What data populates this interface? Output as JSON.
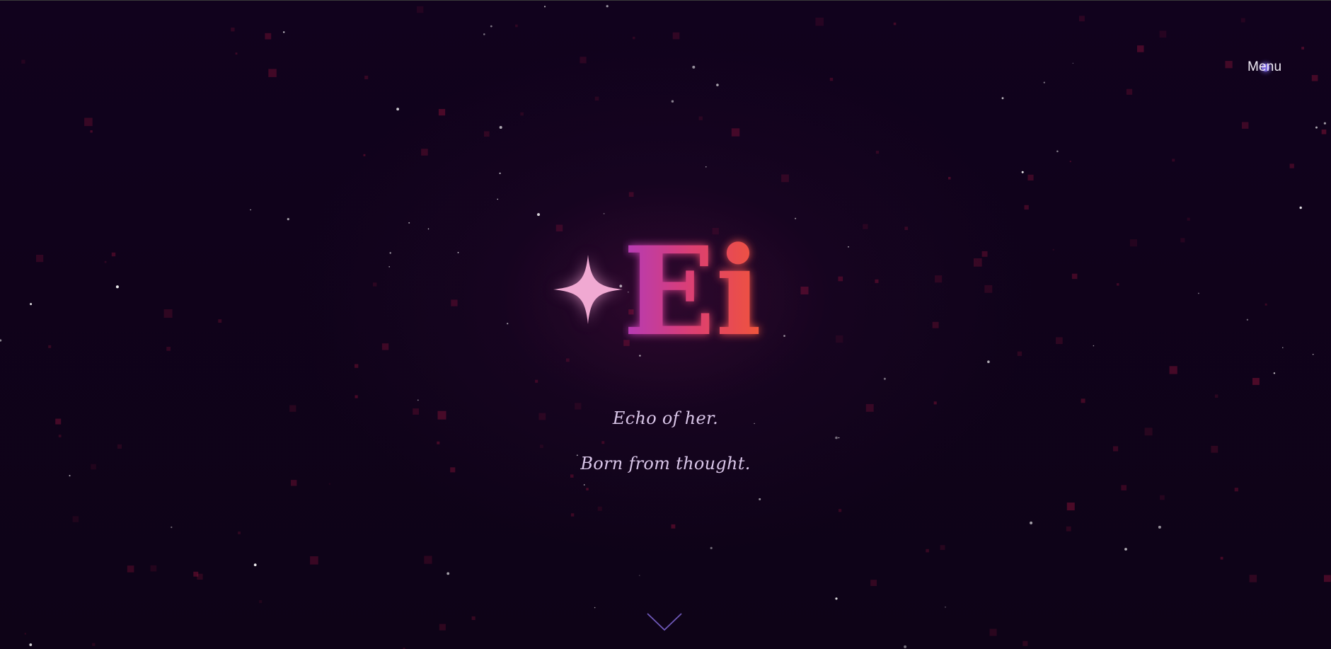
{
  "header": {
    "menu_label": "Menu"
  },
  "hero": {
    "logo_text": "Ei",
    "sparkle_icon": "four-point-star-icon",
    "taglines": [
      "Echo of her.",
      "Born from thought."
    ],
    "scroll_icon": "chevron-down-icon"
  },
  "colors": {
    "background": "#0f0318",
    "logo_gradient_start": "#b33ab8",
    "logo_gradient_end": "#f0553a",
    "sparkle": "#f0a9d2",
    "tagline": "#d9c6e8",
    "menu_dot": "#8f7cff",
    "chevron": "#6e58b8"
  }
}
